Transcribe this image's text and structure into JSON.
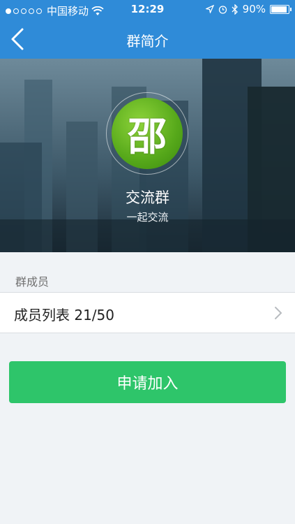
{
  "status_bar": {
    "carrier": "中国移动",
    "time": "12:29",
    "battery_percent": "90%",
    "battery_level": 0.9,
    "icons": [
      "signal-dots-icon",
      "wifi-icon",
      "location-icon",
      "alarm-icon",
      "bluetooth-icon",
      "battery-icon"
    ]
  },
  "nav": {
    "title": "群简介",
    "back_icon": "back-chevron-icon"
  },
  "group": {
    "avatar_char": "邵",
    "name": "交流群",
    "description": "一起交流"
  },
  "members": {
    "section_label": "群成员",
    "row_label": "成员列表 21/50",
    "chevron_icon": "chevron-right-icon"
  },
  "actions": {
    "join_label": "申请加入"
  },
  "colors": {
    "nav_bg": "#2f8bd8",
    "join_button": "#2ec56a",
    "avatar_green": "#56a81a",
    "page_bg": "#f0f3f6"
  }
}
